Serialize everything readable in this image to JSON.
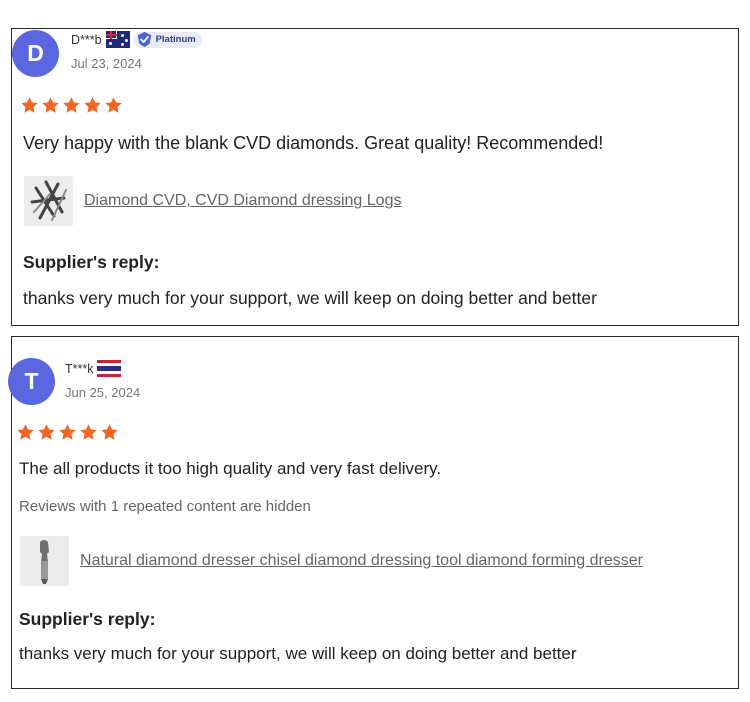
{
  "reviews": [
    {
      "avatar_letter": "D",
      "name": "D***b",
      "country_flag": "australia-flag-icon",
      "badge": "Platinum",
      "date": "Jul 23, 2024",
      "rating": 5,
      "text": "Very happy with the blank CVD diamonds. Great quality! Recommended!",
      "product": "Diamond CVD, CVD Diamond dressing Logs",
      "reply_title": "Supplier's reply:",
      "reply_text": "thanks very much for your support, we will keep on doing better and better"
    },
    {
      "avatar_letter": "T",
      "name": "T***k",
      "country_flag": "thailand-flag-icon",
      "date": "Jun 25, 2024",
      "rating": 5,
      "text": "The all products it too high quality and very fast delivery.",
      "hidden_note": "Reviews with 1 repeated content are hidden",
      "product": "Natural diamond dresser chisel diamond dressing tool diamond forming dresser",
      "reply_title": "Supplier's reply:",
      "reply_text": "thanks very much for your support, we will keep on doing better and better"
    }
  ],
  "colors": {
    "avatar": "#5b67e0",
    "star": "#f26522",
    "badge_text": "#2f3f86",
    "link": "#666666"
  }
}
